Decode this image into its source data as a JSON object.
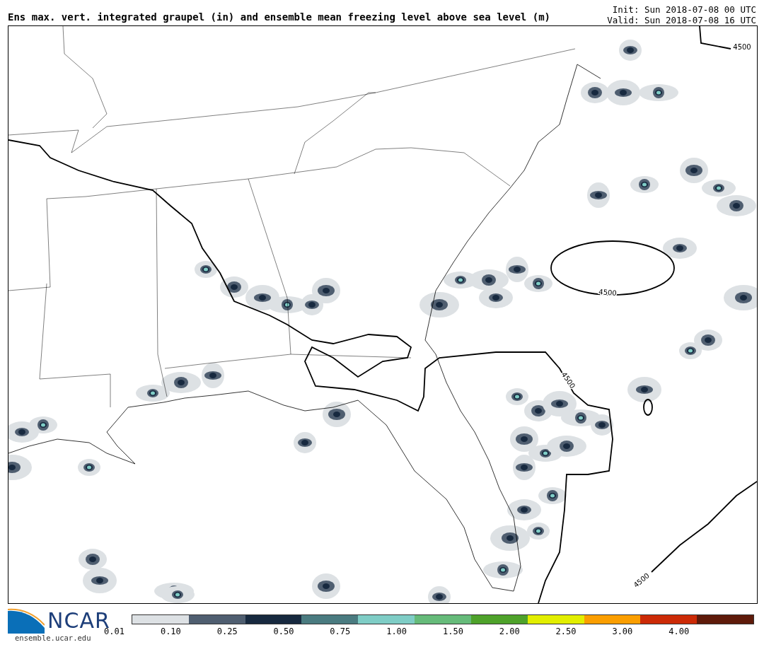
{
  "title": "Ens max. vert. integrated graupel (in) and ensemble mean freezing level above sea level (m)",
  "init": "Init: Sun 2018-07-08 00 UTC",
  "valid": "Valid: Sun 2018-07-08 16 UTC",
  "contour_labels": [
    "4500",
    "4500",
    "4500",
    "4500"
  ],
  "logo": {
    "text": "NCAR",
    "url": "ensemble.ucar.edu"
  },
  "colorbar_bins": [
    {
      "color": "#dde1e4"
    },
    {
      "color": "#4f5e70"
    },
    {
      "color": "#17293f"
    },
    {
      "color": "#4a7b80"
    },
    {
      "color": "#7fcdc6"
    },
    {
      "color": "#66bb7a"
    },
    {
      "color": "#4ea22a"
    },
    {
      "color": "#e2ee00"
    },
    {
      "color": "#fb9e00"
    },
    {
      "color": "#cc2a06"
    },
    {
      "color": "#5e1a0a"
    }
  ],
  "colorbar_ticks": [
    "0.01",
    "0.10",
    "0.25",
    "0.50",
    "0.75",
    "1.00",
    "1.50",
    "2.00",
    "2.50",
    "3.00",
    "4.00"
  ]
}
